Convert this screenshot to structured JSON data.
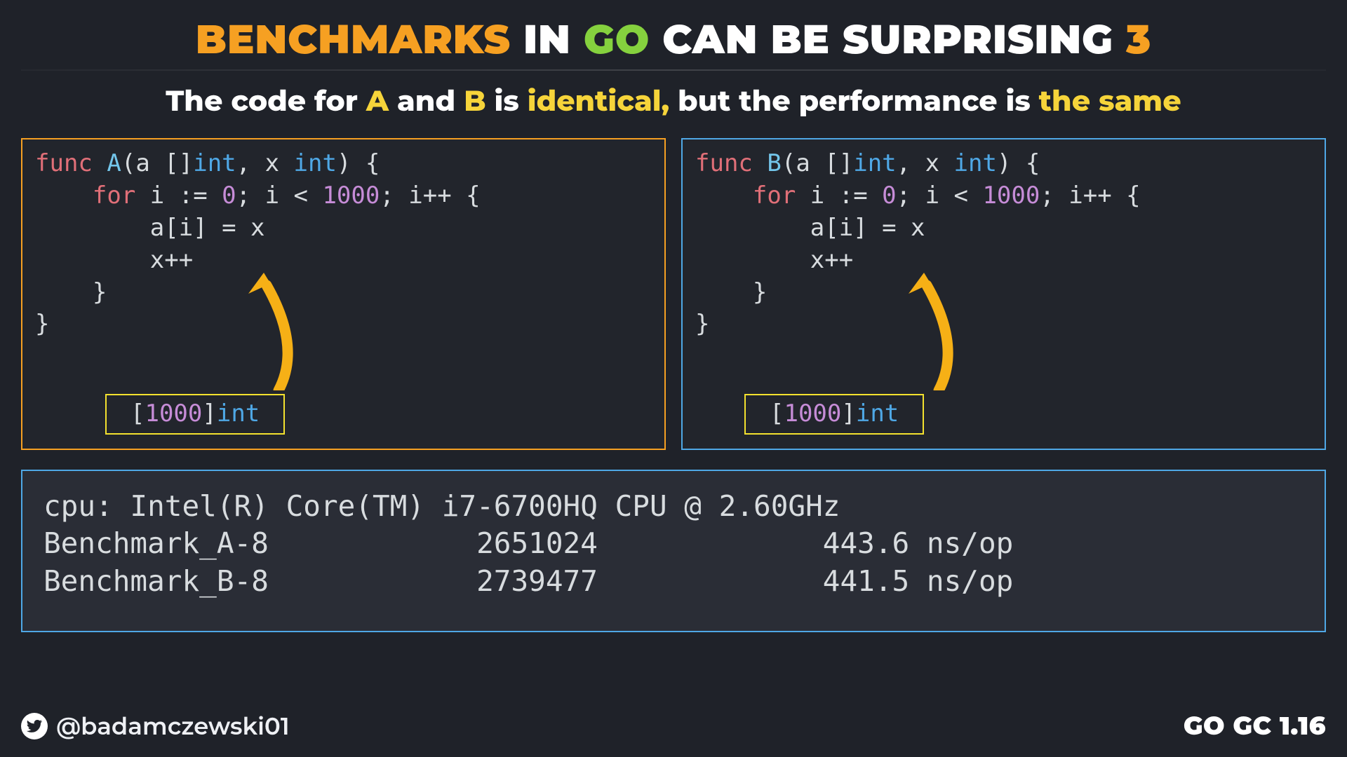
{
  "title": {
    "w1": "BENCHMARKS",
    "w2": "IN",
    "w3": "GO",
    "w4": "CAN BE SURPRISING",
    "num": "3"
  },
  "subtitle": {
    "t1": "The code for ",
    "A": "A",
    "t2": " and ",
    "B": "B",
    "t3": " is ",
    "identical": "identical,",
    "t4": " but the performance is ",
    "same": "the same"
  },
  "code_a": {
    "func": "func",
    "name": "A",
    "sig_open": "(a []",
    "type_int": "int",
    "sig_mid": ", x ",
    "sig_close": ") {",
    "for": "for",
    "loop": " i := ",
    "zero": "0",
    "cond": "; i < ",
    "thousand": "1000",
    "inc": "; i++ {",
    "body1": "        a[i] = x",
    "body2": "        x++",
    "close2": "    }",
    "close1": "}",
    "badge_pre": "[",
    "badge_n": "1000",
    "badge_post": "]"
  },
  "code_b": {
    "func": "func",
    "name": "B",
    "sig_open": "(a []",
    "type_int": "int",
    "sig_mid": ", x ",
    "sig_close": ") {",
    "for": "for",
    "loop": " i := ",
    "zero": "0",
    "cond": "; i < ",
    "thousand": "1000",
    "inc": "; i++ {",
    "body1": "        a[i] = x",
    "body2": "        x++",
    "close2": "    }",
    "close1": "}",
    "badge_pre": "[",
    "badge_n": "1000",
    "badge_post": "]"
  },
  "bench": {
    "cpu": "cpu: Intel(R) Core(TM) i7-6700HQ CPU @ 2.60GHz",
    "rowA": "Benchmark_A-8            2651024             443.6 ns/op",
    "rowB": "Benchmark_B-8            2739477             441.5 ns/op"
  },
  "footer": {
    "handle": "@badamczewski01",
    "version": "GO GC 1.16"
  },
  "chart_data": {
    "type": "table",
    "title": "Benchmark results",
    "cpu": "Intel(R) Core(TM) i7-6700HQ CPU @ 2.60GHz",
    "columns": [
      "name",
      "iterations",
      "ns_per_op"
    ],
    "rows": [
      {
        "name": "Benchmark_A-8",
        "iterations": 2651024,
        "ns_per_op": 443.6
      },
      {
        "name": "Benchmark_B-8",
        "iterations": 2739477,
        "ns_per_op": 441.5
      }
    ]
  }
}
